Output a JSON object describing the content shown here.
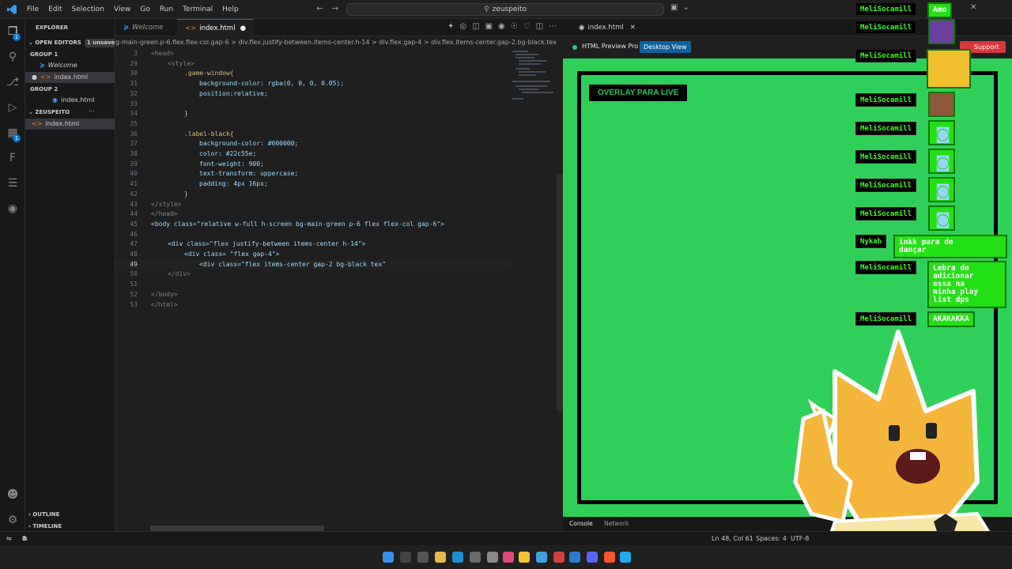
{
  "menu": [
    "File",
    "Edit",
    "Selection",
    "View",
    "Go",
    "Run",
    "Terminal",
    "Help"
  ],
  "search": "zeuspeito",
  "explorer": {
    "title": "EXPLORER",
    "open_editors": "OPEN EDITORS",
    "unsaved_badge": "1 unsaved",
    "group1": "GROUP 1",
    "g1_welcome": "Welcome",
    "g1_index": "index.html",
    "group2": "GROUP 2",
    "g2_index": "index.html",
    "folder": "ZEUSPEITO",
    "folder_index": "index.html",
    "outline": "OUTLINE",
    "timeline": "TIMELINE"
  },
  "tabs": {
    "welcome": "Welcome",
    "index": "index.html"
  },
  "breadcrumb": "g-main-green.p-6.flex.flex-col.gap-6 > div.flex.justify-between.items-center.h-14 > div.flex.gap-4 > div.flex.items-center.gap-2.bg-black.tex",
  "code": [
    {
      "n": "3",
      "text": "<head>"
    },
    {
      "n": "29",
      "text": "<style>"
    },
    {
      "n": "30",
      "text": ".game-window{"
    },
    {
      "n": "31",
      "text": "background-color: rgba(0, 0, 0, 0.05);"
    },
    {
      "n": "32",
      "text": "position:relative;"
    },
    {
      "n": "33",
      "text": ""
    },
    {
      "n": "34",
      "text": "}"
    },
    {
      "n": "35",
      "text": ""
    },
    {
      "n": "36",
      "text": ".label-black{"
    },
    {
      "n": "37",
      "text": "background-color: #000000;"
    },
    {
      "n": "38",
      "text": "color: #22c55e;"
    },
    {
      "n": "39",
      "text": "font-weight: 900;"
    },
    {
      "n": "40",
      "text": "text-transform: uppercase;"
    },
    {
      "n": "41",
      "text": "padding: 4px 16px;"
    },
    {
      "n": "42",
      "text": "}"
    },
    {
      "n": "43",
      "text": "</style>"
    },
    {
      "n": "44",
      "text": "</head>"
    },
    {
      "n": "45",
      "text": "<body class=\"relative w-full h-screen bg-main-green p-6 flex flex-col gap-6\">"
    },
    {
      "n": "46",
      "text": ""
    },
    {
      "n": "47",
      "text": "<div class=\"flex justify-between items-center h-14\">"
    },
    {
      "n": "48",
      "text": "<div class= \"flex gap-4\">"
    },
    {
      "n": "49",
      "text": "<div class=\"flex items-center gap-2 bg-black tex\""
    },
    {
      "n": "50",
      "text": "</div>"
    },
    {
      "n": "51",
      "text": ""
    },
    {
      "n": "52",
      "text": "</body>"
    },
    {
      "n": "53",
      "text": "</html>"
    }
  ],
  "preview": {
    "tab": "index.html",
    "title": "HTML Preview Pro",
    "desktop_view": "Desktop View",
    "support": "Support",
    "overlay_label": "OVERLAY PARA LIVE",
    "console": "Console",
    "network": "Network"
  },
  "chat": [
    {
      "name": "MeliSocamill",
      "msg": "Amo"
    },
    {
      "name": "MeliSocamill",
      "msg": ""
    },
    {
      "name": "MeliSocamill",
      "msg": ""
    },
    {
      "name": "MeliSocamill",
      "msg": ""
    },
    {
      "name": "MeliSocamill",
      "msg": ""
    },
    {
      "name": "MeliSocamill",
      "msg": ""
    },
    {
      "name": "MeliSocamill",
      "msg": ""
    },
    {
      "name": "MeliSocamill",
      "msg": ""
    },
    {
      "name": "Nykah",
      "msg": "inkk para de\ndançar"
    },
    {
      "name": "MeliSocamill",
      "msg": "Lebra de\nadicionar\nessa na\nminha play\nlist dps"
    },
    {
      "name": "MeliSocamill",
      "msg": "AKAKAKKA"
    }
  ],
  "status": {
    "errors": "0",
    "warnings": "0",
    "position": "Ln 48, Col 61",
    "spaces": "Spaces: 4",
    "encoding": "UTF-8"
  },
  "colors": {
    "accent": "#0078d4",
    "preview_green": "#2fd05a",
    "chat_green": "#22e014",
    "label_green": "#22c55e"
  }
}
